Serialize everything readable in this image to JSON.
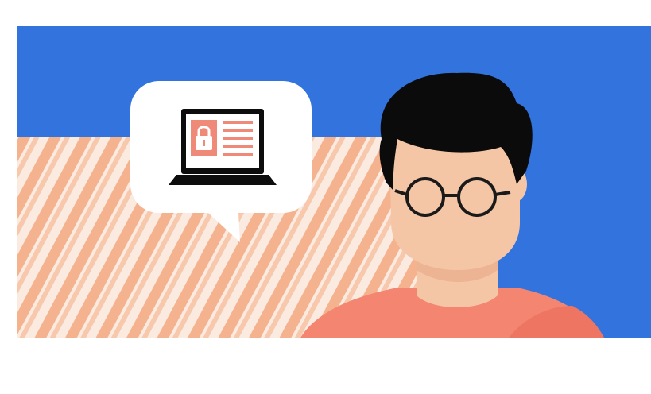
{
  "illustration": {
    "subject": "person-with-glasses",
    "speech_bubble_icon": "laptop-lock-icon"
  },
  "colors": {
    "page_background": "#ffffff",
    "banner_blue": "#3373dd",
    "stripe_light": "#fbeae0",
    "stripe_orange": "#f4b38e",
    "bubble_fill": "#ffffff",
    "laptop_black": "#0d0d0d",
    "screen_accent": "#f08a78",
    "skin": "#f5c6a6",
    "skin_shadow": "#edb493",
    "hair": "#0b0b0b",
    "shirt": "#f48570",
    "shirt_shadow": "#ef7563"
  }
}
